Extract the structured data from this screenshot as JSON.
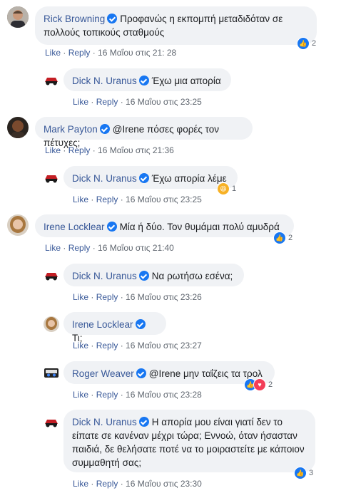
{
  "colors": {
    "link": "#385898",
    "verified": "#1877f2",
    "bubble": "#f0f2f5",
    "muted": "#606770"
  },
  "comments": [
    {
      "name": "Rick Browning",
      "text": "Προφανώς η εκπομπή μεταδιδόταν σε πολλούς τοπικούς σταθμούς",
      "like": "Like",
      "reply": "Reply",
      "time": "16 Μαΐου στις 21: 28",
      "reaction_count": "2"
    },
    {
      "name": "Dick N. Uranus",
      "text": "Έχω μια απορία",
      "like": "Like",
      "reply": "Reply",
      "time": "16 Μαΐου στις 23:25"
    },
    {
      "name": "Mark Payton",
      "text": "@Irene πόσες φορές τον πέτυχες;",
      "like": "Like",
      "reply": "Reply",
      "time": "16 Μαΐου στις 21:36"
    },
    {
      "name": "Dick N. Uranus",
      "text": "Έχω απορία λέμε",
      "like": "Like",
      "reply": "Reply",
      "time": "16 Μαΐου στις 23:25",
      "reaction_count": "1"
    },
    {
      "name": "Irene Locklear",
      "text": "Μία ή δύο. Τον θυμάμαι πολύ αμυδρά",
      "like": "Like",
      "reply": "Reply",
      "time": "16 Μαΐου στις 21:40",
      "reaction_count": "2"
    },
    {
      "name": "Dick N. Uranus",
      "text": "Να ρωτήσω εσένα;",
      "like": "Like",
      "reply": "Reply",
      "time": "16 Μαΐου στις 23:26"
    },
    {
      "name": "Irene Locklear",
      "text": "Τι;",
      "like": "Like",
      "reply": "Reply",
      "time": "16 Μαΐου στις 23:27"
    },
    {
      "name": "Roger Weaver",
      "text": "@Irene μην ταΐζεις τα τρολ",
      "like": "Like",
      "reply": "Reply",
      "time": "16 Μαΐου στις 23:28",
      "reaction_count": "2"
    },
    {
      "name": "Dick N. Uranus",
      "text": "Η απορία μου είναι γιατί δεν το είπατε σε κανέναν μέχρι τώρα; Εννοώ, όταν ήσασταν παιδιά, δε θελήσατε ποτέ να το μοιραστείτε με κάποιον συμμαθητή σας;",
      "like": "Like",
      "reply": "Reply",
      "time": "16 Μαΐου στις 23:30",
      "reaction_count": "3"
    }
  ]
}
